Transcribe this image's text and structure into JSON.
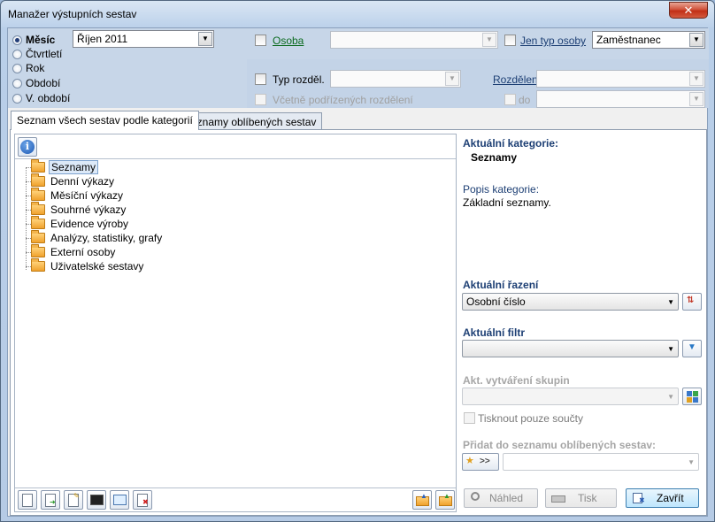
{
  "window": {
    "title": "Manažer výstupních sestav",
    "close_symbol": "✕"
  },
  "period": {
    "options": [
      "Měsíc",
      "Čtvrtletí",
      "Rok",
      "Období",
      "V. období"
    ],
    "selected_index": 0,
    "month_value": "Říjen 2011"
  },
  "filters": {
    "osoba_label": "Osoba",
    "osoba_value": "",
    "jen_typ_osoby_label": "Jen typ osoby",
    "typ_osoby_value": "Zaměstnanec",
    "typ_rozdel_label": "Typ rozděl.",
    "typ_rozdel_value": "",
    "rozdeleni_label": "Rozdělení",
    "rozdeleni_value": "",
    "vcetne_label": "Včetně podřízených rozdělení",
    "do_label": "do",
    "do_value": ""
  },
  "tabs": [
    {
      "label": "Seznam všech sestav podle kategorií",
      "active": true
    },
    {
      "label": "Seznamy oblíbených sestav",
      "active": false
    }
  ],
  "tree": {
    "items": [
      {
        "label": "Seznamy",
        "selected": true
      },
      {
        "label": "Denní výkazy",
        "selected": false
      },
      {
        "label": "Měsíční výkazy",
        "selected": false
      },
      {
        "label": "Souhrné výkazy",
        "selected": false
      },
      {
        "label": "Evidence výroby",
        "selected": false
      },
      {
        "label": "Analýzy, statistiky, grafy",
        "selected": false
      },
      {
        "label": "Externí osoby",
        "selected": false
      },
      {
        "label": "Uživatelské sestavy",
        "selected": false
      }
    ]
  },
  "details": {
    "current_category_label": "Aktuální kategorie:",
    "current_category_value": "Seznamy",
    "description_label": "Popis kategorie:",
    "description_value": "Základní seznamy.",
    "sort_label": "Aktuální řazení",
    "sort_value": "Osobní číslo",
    "filter_label": "Aktuální filtr",
    "filter_value": "",
    "grouping_label": "Akt. vytváření skupin",
    "grouping_value": "",
    "print_totals_label": "Tisknout pouze součty",
    "add_favorites_label": "Přidat do seznamu oblíbených sestav:",
    "add_button_label": ">>",
    "favorites_value": ""
  },
  "buttons": {
    "preview_label": "Náhled",
    "print_label": "Tisk",
    "close_label": "Zavřít"
  },
  "colors": {
    "accent": "#1d3f74",
    "link": "#0a6a1e",
    "folder": "#f0a22d"
  }
}
